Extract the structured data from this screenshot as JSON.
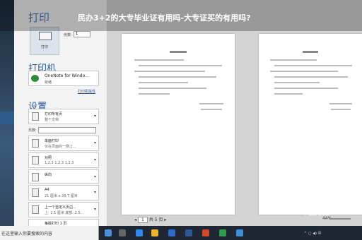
{
  "overlay_title": "民办3+2的大专毕业证有用吗-大专证买的有用吗?",
  "print": {
    "heading": "打印",
    "button_label": "打印",
    "copies_label": "份数:",
    "copies_value": "1"
  },
  "printer": {
    "heading": "打印机",
    "name": "OneNote for Windo...",
    "status": "就绪",
    "properties_link": "打印机属性"
  },
  "settings": {
    "heading": "设置",
    "pages_label": "页数:",
    "items": [
      {
        "main": "打印所有页",
        "sub": "整个文档"
      },
      {
        "main": "单面打印",
        "sub": "仅在页面的一侧上..."
      },
      {
        "main": "对照",
        "sub": "1,2,3   1,2,3   1,2,3"
      },
      {
        "main": "纵向",
        "sub": ""
      },
      {
        "main": "A4",
        "sub": "21 厘米 x 29.7 厘米"
      },
      {
        "main": "上一个自定义页边...",
        "sub": "上: 2.5 厘米 底部: 2.5..."
      },
      {
        "main": "每版打印 1 页",
        "sub": ""
      }
    ]
  },
  "nav": {
    "current_page": "1",
    "of_text": "共 5 页"
  },
  "zoom": "44%",
  "taskbar": {
    "search_text": "在这里输入你要搜索的内容"
  },
  "watermark": "Bai 经验"
}
